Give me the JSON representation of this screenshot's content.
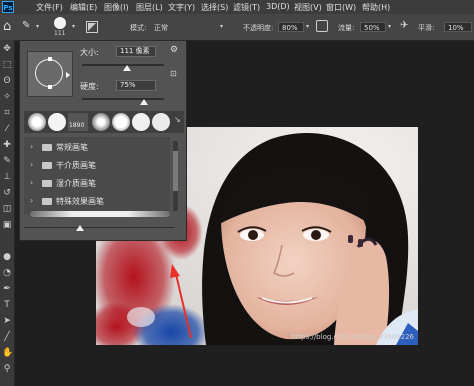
{
  "menubar": {
    "logo": "Ps",
    "items": [
      "文件(F)",
      "编辑(E)",
      "图像(I)",
      "图层(L)",
      "文字(Y)",
      "选择(S)",
      "滤镜(T)",
      "3D(D)",
      "视图(V)",
      "窗口(W)",
      "帮助(H)"
    ]
  },
  "options": {
    "brush_size": "111",
    "mode_label": "模式:",
    "mode_value": "正常",
    "opacity_label": "不透明度:",
    "opacity_value": "80%",
    "flow_label": "流量:",
    "flow_value": "50%",
    "smoothing_label": "平滑:",
    "smoothing_value": "10%"
  },
  "brush_panel": {
    "size_label": "大小:",
    "size_value": "111 像素",
    "hardness_label": "硬度:",
    "hardness_value": "75%",
    "size_fraction": 0.55,
    "hardness_fraction": 0.75,
    "preset_number": "1890",
    "folders": [
      "常规画笔",
      "干介质画笔",
      "湿介质画笔",
      "特殊效果画笔"
    ]
  },
  "watermark": "https://blog.csdn.net/qq_39969226",
  "annotation_color": "#e8312b"
}
